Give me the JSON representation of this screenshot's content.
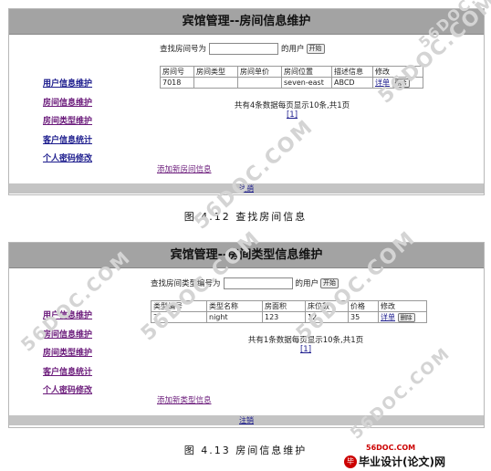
{
  "figure1": {
    "title": "宾馆管理--房间信息维护",
    "sidebar": [
      "用户信息维护",
      "房间信息维护",
      "房间类型维护",
      "客户信息统计",
      "个人密码修改"
    ],
    "search": {
      "prefix": "查找房间号为",
      "value": "",
      "suffix": "的用户",
      "button": "开始"
    },
    "columns": [
      "房间号",
      "房间类型",
      "房间单价",
      "房间位置",
      "描述信息",
      "修改"
    ],
    "rows": [
      {
        "cells": [
          "7018",
          "",
          "",
          "seven-east",
          "ABCD"
        ],
        "edit": "详单",
        "delete": "删除"
      }
    ],
    "pager_text": "共有4条数据每页显示10条,共1页",
    "page_link": "[1]",
    "add_link": "添加新房间信息",
    "logout": "注销",
    "caption": "图 4.12  查找房间信息"
  },
  "figure2": {
    "title": "宾馆管理--房间类型信息维护",
    "sidebar": [
      "用户信息维护",
      "房间信息维护",
      "房间类型维护",
      "客户信息统计",
      "个人密码修改"
    ],
    "search": {
      "prefix": "查找房间类型编号为",
      "value": "",
      "suffix": "的用户",
      "button": "开始"
    },
    "columns": [
      "类型编号",
      "类型名称",
      "房面积",
      "床位数",
      "价格",
      "修改"
    ],
    "rows": [
      {
        "cells": [
          "2",
          "night",
          "123",
          "12",
          "35"
        ],
        "edit": "详单",
        "delete": "删除"
      }
    ],
    "pager_text": "共有1条数据每页显示10条,共1页",
    "page_link": "[1]",
    "add_link": "添加新类型信息",
    "logout": "注销",
    "caption": "图 4.13  房间信息维护"
  },
  "watermark": "56DOC.COM",
  "logo": {
    "domain": "56DOC.COM",
    "text": "毕业设计(论文)网",
    "badge": "毕"
  }
}
